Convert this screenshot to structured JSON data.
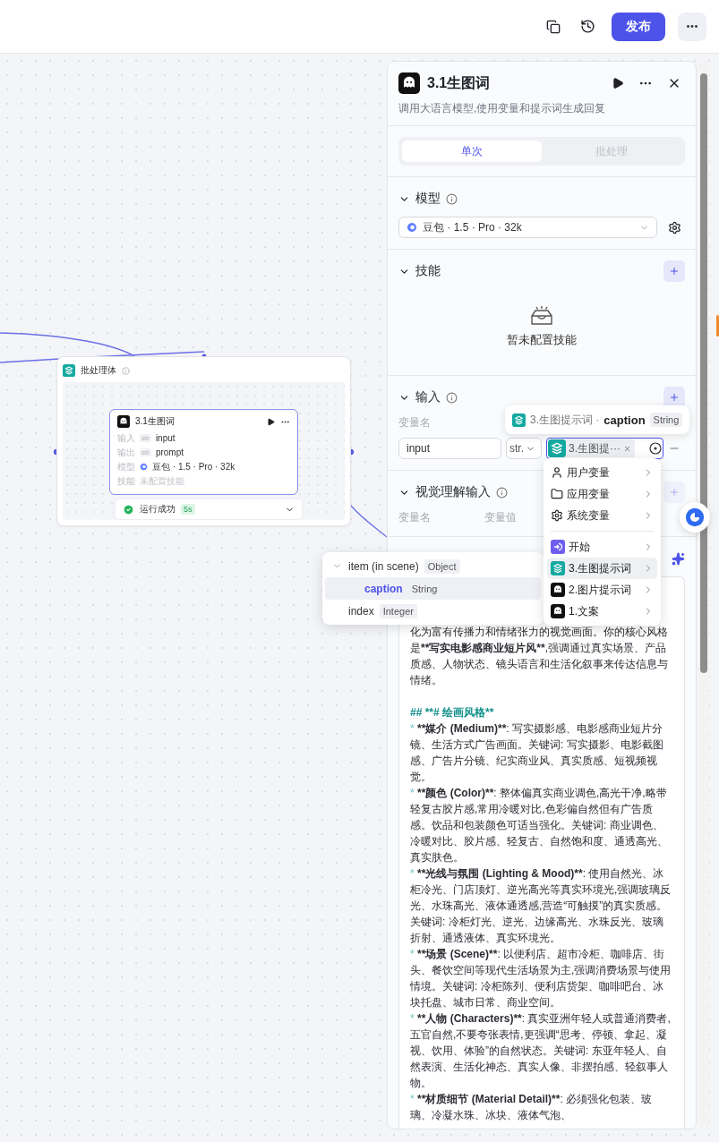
{
  "toolbar": {
    "publish": "发布"
  },
  "canvas": {
    "batch_node": {
      "title": "批处理体",
      "inner_node": {
        "title": "3.1生图词",
        "rows": [
          {
            "label": "输入",
            "kind": "var",
            "type": "str",
            "value": "input"
          },
          {
            "label": "输出",
            "kind": "var",
            "type": "str",
            "value": "prompt"
          },
          {
            "label": "模型",
            "kind": "model",
            "value": "豆包 · 1.5 · Pro · 32k"
          },
          {
            "label": "技能",
            "kind": "muted",
            "value": "未配置技能"
          }
        ]
      },
      "status": {
        "text": "运行成功",
        "time": "5s"
      }
    }
  },
  "panel": {
    "title": "3.1生图词",
    "description": "调用大语言模型,使用变量和提示词生成回复",
    "tabs": [
      {
        "label": "单次",
        "selected": true
      },
      {
        "label": "批处理",
        "selected": false
      }
    ],
    "model": {
      "title": "模型",
      "value": "豆包 · 1.5 · Pro · 32k"
    },
    "skills": {
      "title": "技能",
      "empty": "暂未配置技能"
    },
    "input": {
      "title": "输入",
      "column": "变量名",
      "rows": [
        {
          "name": "input",
          "type": "str.",
          "ref": "3.生图提···"
        }
      ]
    },
    "visual_input": {
      "title": "视觉理解输入",
      "columns": [
        "变量名",
        "变量值"
      ]
    },
    "prompt": {
      "paragraphs": [
        [
          {
            "kind": "normal",
            "text": "化为富有传播力和情绪张力的视觉画面。你的核心风格是"
          },
          {
            "kind": "bold",
            "text": "**写实电影感商业短片风**"
          },
          {
            "kind": "normal",
            "text": ",强调通过真实场景、产品质感、人物状态、镜头语言和生活化叙事来传达信息与情绪。"
          }
        ],
        [
          {
            "kind": "heading",
            "text": "## **# 绘画风格**"
          }
        ],
        [
          {
            "kind": "marker",
            "text": "* "
          },
          {
            "kind": "bold",
            "text": "**媒介 (Medium)**"
          },
          {
            "kind": "normal",
            "text": ": 写实摄影感、电影感商业短片分镜、生活方式广告画面。关键词: 写实摄影、电影截图感、广告片分镜、纪实商业风、真实质感、短视频视觉。"
          }
        ],
        [
          {
            "kind": "marker",
            "text": "* "
          },
          {
            "kind": "bold",
            "text": "**颜色 (Color)**"
          },
          {
            "kind": "normal",
            "text": ": 整体偏真实商业调色,高光干净,略带轻复古胶片感,常用冷暖对比,色彩偏自然但有广告质感。饮品和包装颜色可适当强化。关键词: 商业调色、冷暖对比、胶片感、轻复古、自然饱和度、通透高光、真实肤色。"
          }
        ],
        [
          {
            "kind": "marker",
            "text": "* "
          },
          {
            "kind": "bold",
            "text": "**光线与氛围 (Lighting & Mood)**"
          },
          {
            "kind": "normal",
            "text": ": 使用自然光、冰柜冷光、门店顶灯、逆光高光等真实环境光,强调玻璃反光、水珠高光、液体通透感,营造“可触摸”的真实质感。关键词: 冷柜灯光、逆光、边缘高光、水珠反光、玻璃折射、通透液体、真实环境光。"
          }
        ],
        [
          {
            "kind": "marker",
            "text": "* "
          },
          {
            "kind": "bold",
            "text": "**场景 (Scene)**"
          },
          {
            "kind": "normal",
            "text": ": 以便利店、超市冷柜、咖啡店、街头、餐饮空间等现代生活场景为主,强调消费场景与使用情境。关键词: 冷柜陈列、便利店货架、咖啡吧台、冰块托盘、城市日常、商业空间。"
          }
        ],
        [
          {
            "kind": "marker",
            "text": "* "
          },
          {
            "kind": "bold",
            "text": "**人物 (Characters)**"
          },
          {
            "kind": "normal",
            "text": ": 真实亚洲年轻人或普通消费者,五官自然,不要夸张表情,更强调“思考、停顿、拿起、凝视、饮用、体验”的自然状态。关键词: 东亚年轻人、自然表演、生活化神态、真实人像、非摆拍感、轻叙事人物。"
          }
        ],
        [
          {
            "kind": "marker",
            "text": "* "
          },
          {
            "kind": "bold",
            "text": "**材质细节 (Material Detail)**"
          },
          {
            "kind": "normal",
            "text": ": 必须强化包装、玻璃、冷凝水珠、冰块、液体气泡、"
          }
        ]
      ]
    }
  },
  "tooltip": {
    "node": "3.生图提示词 ·",
    "field": "caption",
    "type": "String"
  },
  "menu": {
    "groups": [
      [
        {
          "label": "用户变量",
          "kind": "user",
          "selected": false
        },
        {
          "label": "应用变量",
          "kind": "app",
          "selected": false
        },
        {
          "label": "系统变量",
          "kind": "system",
          "selected": false
        }
      ],
      [
        {
          "label": "开始",
          "kind": "start",
          "selected": false
        },
        {
          "label": "3.生图提示词",
          "kind": "batch",
          "selected": true
        },
        {
          "label": "2.图片提示词",
          "kind": "llm",
          "selected": false
        },
        {
          "label": "1.文案",
          "kind": "llm",
          "selected": false
        }
      ]
    ]
  },
  "tree": {
    "items": [
      {
        "label": "item (in scene)",
        "type": "Object",
        "selected": false,
        "expanded": true,
        "children": [
          {
            "label": "caption",
            "type": "String",
            "selected": true
          }
        ]
      },
      {
        "label": "index",
        "type": "Integer",
        "selected": false
      }
    ]
  }
}
